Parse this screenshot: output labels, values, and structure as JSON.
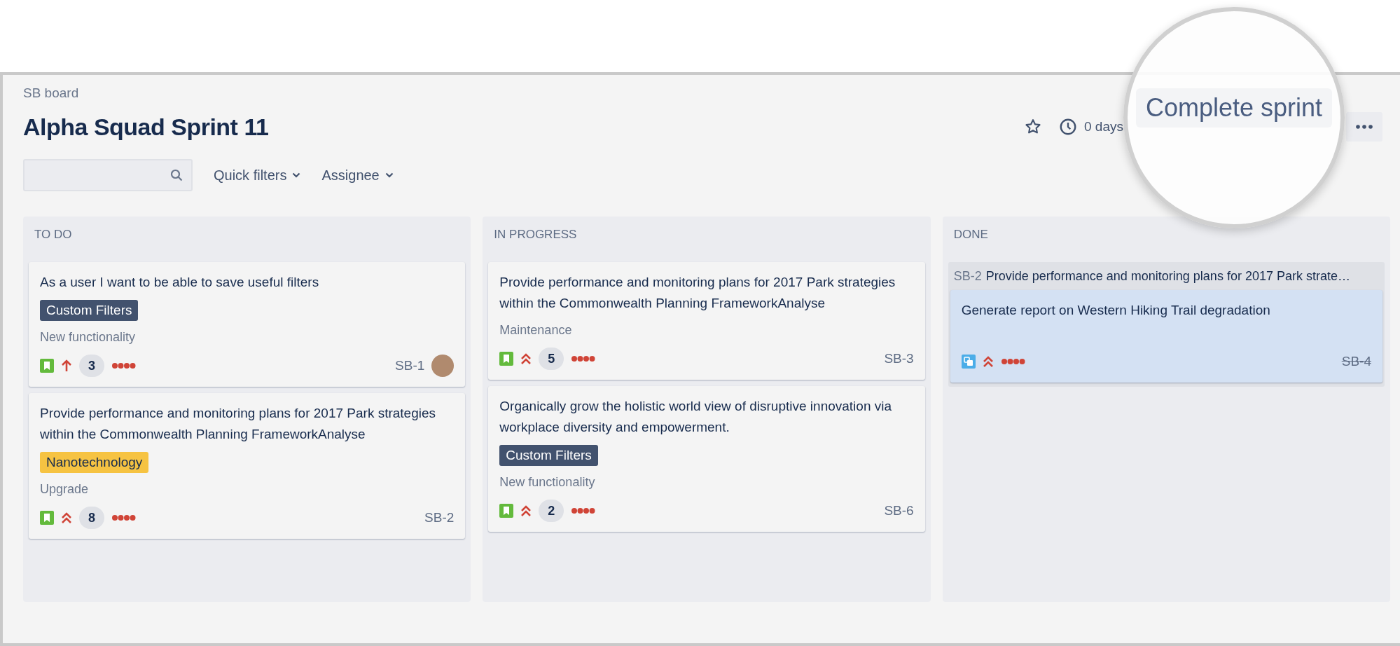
{
  "header": {
    "breadcrumb": "SB board",
    "title": "Alpha Squad Sprint 11",
    "remaining": "0 days",
    "magnifier_label": "Complete sprint"
  },
  "filters": [
    "Quick filters",
    "Assignee"
  ],
  "columns": [
    {
      "title": "TO DO",
      "cards": [
        {
          "summary": "As a user I want to be able to save useful filters",
          "label": {
            "text": "Custom Filters",
            "color": "#42526e"
          },
          "category": "New functionality",
          "issue_type": {
            "kind": "story"
          },
          "priority": {
            "kind": "high"
          },
          "estimate": "3",
          "key": "SB-1",
          "done": false,
          "avatar": true
        },
        {
          "summary": "Provide performance and monitoring plans for 2017 Park strategies within the Commonwealth Planning FrameworkAnalyse",
          "label": {
            "text": "Nanotechnology",
            "color": "#f6c342"
          },
          "category": "Upgrade",
          "issue_type": {
            "kind": "story"
          },
          "priority": {
            "kind": "highest"
          },
          "estimate": "8",
          "key": "SB-2",
          "done": false,
          "avatar": false
        }
      ]
    },
    {
      "title": "IN PROGRESS",
      "cards": [
        {
          "summary": "Provide performance and monitoring plans for 2017 Park strategies within the Commonwealth Planning FrameworkAnalyse",
          "category": "Maintenance",
          "issue_type": {
            "kind": "story"
          },
          "priority": {
            "kind": "highest"
          },
          "estimate": "5",
          "key": "SB-3",
          "done": false,
          "avatar": false
        },
        {
          "summary": "Organically grow the holistic world view of disruptive innovation via workplace diversity and empowerment.",
          "label": {
            "text": "Custom Filters",
            "color": "#42526e"
          },
          "category": "New functionality",
          "issue_type": {
            "kind": "story"
          },
          "priority": {
            "kind": "highest"
          },
          "estimate": "2",
          "key": "SB-6",
          "done": false,
          "avatar": false
        }
      ]
    },
    {
      "title": "DONE",
      "parent": {
        "key": "SB-2",
        "summary": "Provide performance and monitoring plans for 2017 Park strate…"
      },
      "cards": [
        {
          "summary": "Generate report on Western Hiking Trail degradation",
          "issue_type": {
            "kind": "subtask"
          },
          "priority": {
            "kind": "highest"
          },
          "key": "SB-4",
          "done": true,
          "avatar": false
        }
      ]
    }
  ]
}
